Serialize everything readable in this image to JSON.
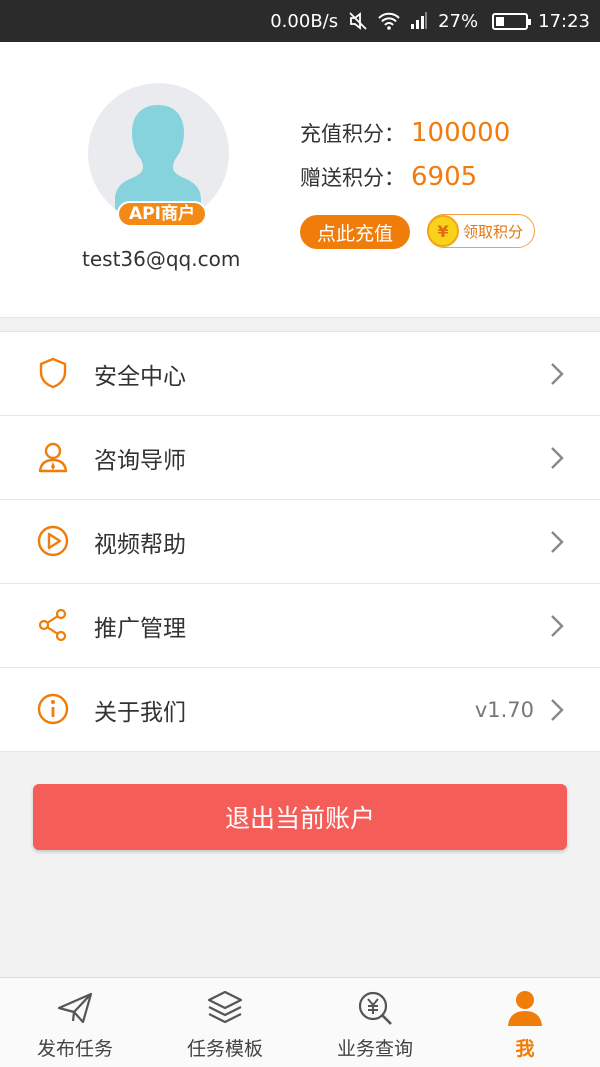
{
  "status_bar": {
    "net_speed": "0.00B/s",
    "battery": "27%",
    "battery_level": 0.27,
    "time": "17:23"
  },
  "profile": {
    "badge": "API商户",
    "email": "test36@qq.com",
    "recharge_label": "充值积分：",
    "recharge_value": "100000",
    "gift_label": "赠送积分：",
    "gift_value": "6905",
    "recharge_button": "点此充值",
    "claim_button": "领取积分",
    "coin_symbol": "¥"
  },
  "menu": {
    "items": [
      {
        "label": "安全中心",
        "icon": "shield-icon"
      },
      {
        "label": "咨询导师",
        "icon": "person-icon"
      },
      {
        "label": "视频帮助",
        "icon": "play-icon"
      },
      {
        "label": "推广管理",
        "icon": "share-icon"
      },
      {
        "label": "关于我们",
        "icon": "info-icon",
        "version": "v1.70"
      }
    ]
  },
  "logout_button": "退出当前账户",
  "tabbar": {
    "tabs": [
      {
        "label": "发布任务",
        "icon": "paper-plane-icon"
      },
      {
        "label": "任务模板",
        "icon": "layers-icon"
      },
      {
        "label": "业务查询",
        "icon": "search-yen-icon"
      },
      {
        "label": "我",
        "icon": "user-icon",
        "active": true
      }
    ]
  },
  "colors": {
    "accent": "#f07d0a",
    "logout": "#f45d58",
    "status_bar": "#2b2b2b"
  }
}
